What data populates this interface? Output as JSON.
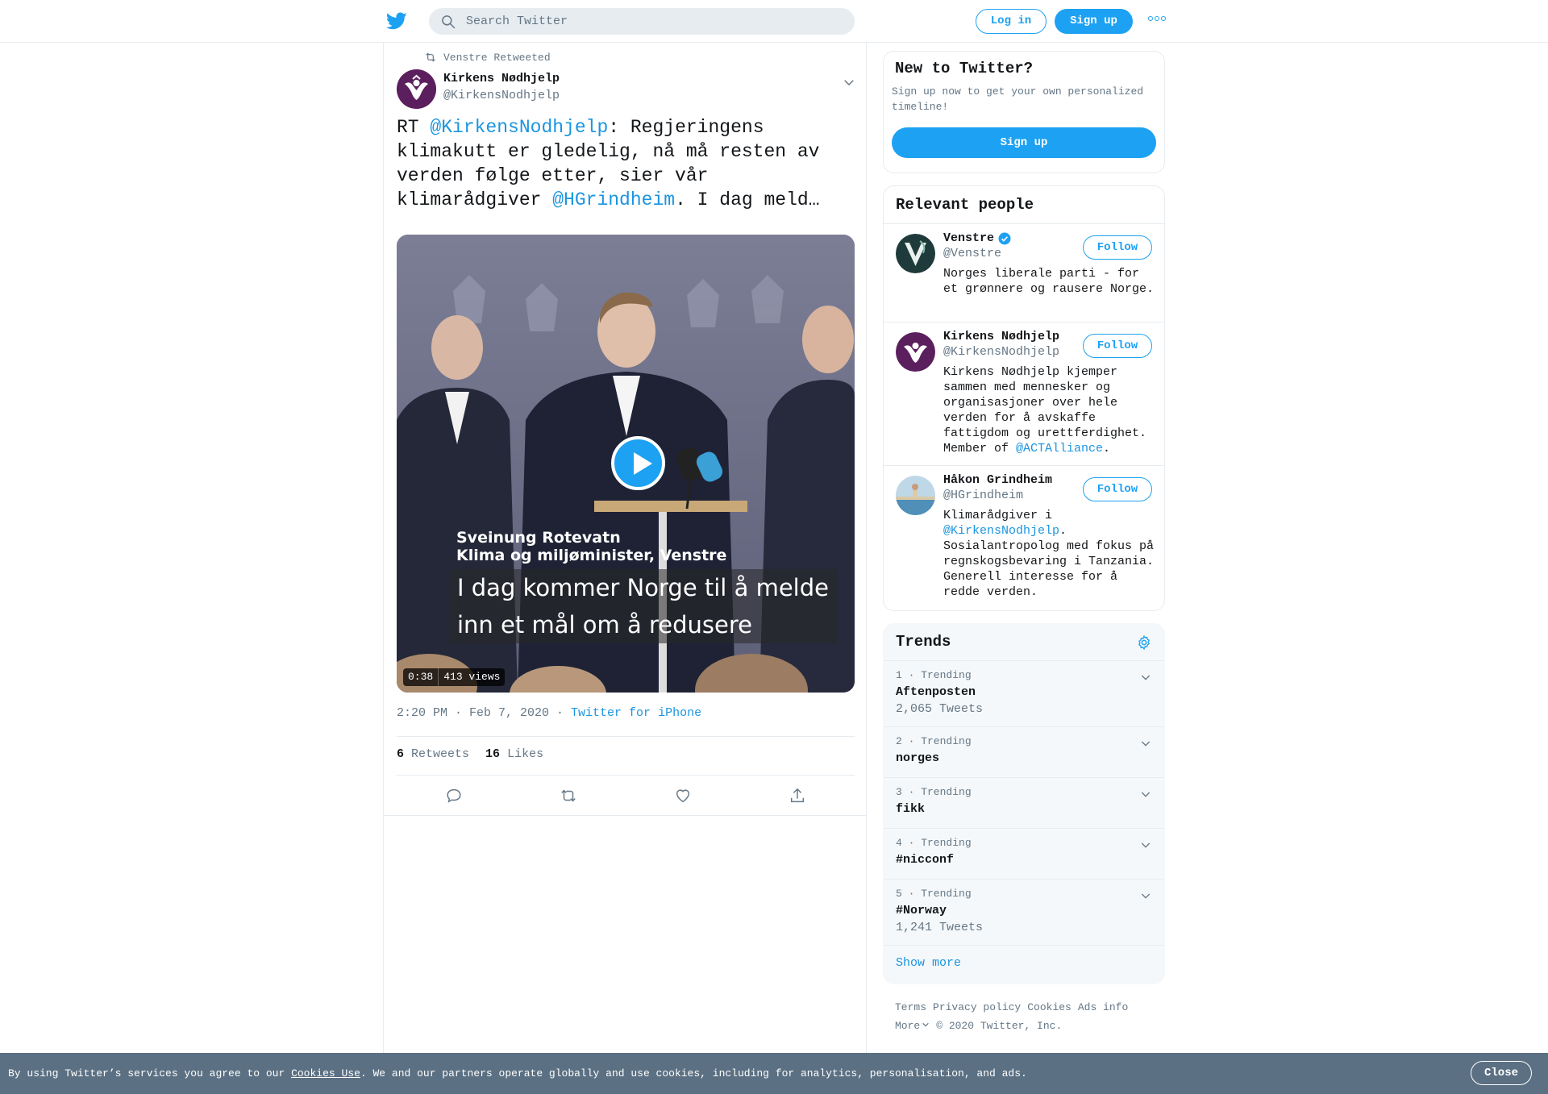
{
  "header": {
    "search_placeholder": "Search Twitter",
    "login_label": "Log in",
    "signup_label": "Sign up"
  },
  "tweet": {
    "retweet_context": "Venstre Retweeted",
    "author_name": "Kirkens Nødhjelp",
    "author_handle": "@KirkensNodhjelp",
    "text_prefix": "RT ",
    "mention_1": "@KirkensNodhjelp",
    "text_middle": ": Regjeringens klimakutt er gledelig, nå må resten av verden følge etter, sier vår klimarådgiver ",
    "mention_2": "@HGrindheim",
    "text_suffix": ". I dag meld…",
    "video": {
      "caption_line1": "I dag kommer Norge til å melde",
      "caption_line2": "inn et mål om å redusere",
      "lower_third_name": "Sveinung Rotevatn",
      "lower_third_title": "Klima og miljøminister, Venstre",
      "duration": "0:38",
      "views": "413 views"
    },
    "timestamp": "2:20 PM · Feb 7, 2020",
    "separator": " · ",
    "source": "Twitter for iPhone",
    "retweets_count": "6",
    "retweets_label": "Retweets",
    "likes_count": "16",
    "likes_label": "Likes"
  },
  "new_to_twitter": {
    "title": "New to Twitter?",
    "description": "Sign up now to get your own personalized timeline!",
    "signup_label": "Sign up"
  },
  "relevant_people": {
    "title": "Relevant people",
    "follow_label": "Follow",
    "people": [
      {
        "name": "Venstre",
        "handle": "@Venstre",
        "bio": "Norges liberale parti - for et grønnere og rausere Norge."
      },
      {
        "name": "Kirkens Nødhjelp",
        "handle": "@KirkensNodhjelp",
        "bio_text": "Kirkens Nødhjelp kjemper sammen med mennesker og organisasjoner over hele verden for å avskaffe fattigdom og urettferdighet. Member of ",
        "bio_link": "@ACTAlliance",
        "bio_end": "."
      },
      {
        "name": "Håkon Grindheim",
        "handle": "@HGrindheim",
        "bio_text": "Klimarådgiver i ",
        "bio_link": "@KirkensNodhjelp",
        "bio_end": ". Sosialantropolog med fokus på regnskogsbevaring i Tanzania. Generell interesse for å redde verden."
      }
    ]
  },
  "trends": {
    "title": "Trends",
    "items": [
      {
        "rank": "1 · Trending",
        "name": "Aftenposten",
        "count": "2,065 Tweets"
      },
      {
        "rank": "2 · Trending",
        "name": "norges",
        "count": ""
      },
      {
        "rank": "3 · Trending",
        "name": "fikk",
        "count": ""
      },
      {
        "rank": "4 · Trending",
        "name": "#nicconf",
        "count": ""
      },
      {
        "rank": "5 · Trending",
        "name": "#Norway",
        "count": "1,241 Tweets"
      }
    ],
    "show_more": "Show more"
  },
  "footer": {
    "terms": "Terms",
    "privacy": "Privacy policy",
    "cookies": "Cookies",
    "ads": "Ads info",
    "more": "More",
    "copyright": "© 2020 Twitter, Inc."
  },
  "cookie_bar": {
    "text_before": "By using Twitter’s services you agree to our ",
    "link": "Cookies Use",
    "text_after": ". We and our partners operate globally and use cookies, including for analytics, personalisation, and ads.",
    "close_label": "Close"
  },
  "colors": {
    "accent": "#1da1f2",
    "link": "#1b95e0",
    "secondary_text": "#657786",
    "cookie_bar": "#5b7083"
  }
}
